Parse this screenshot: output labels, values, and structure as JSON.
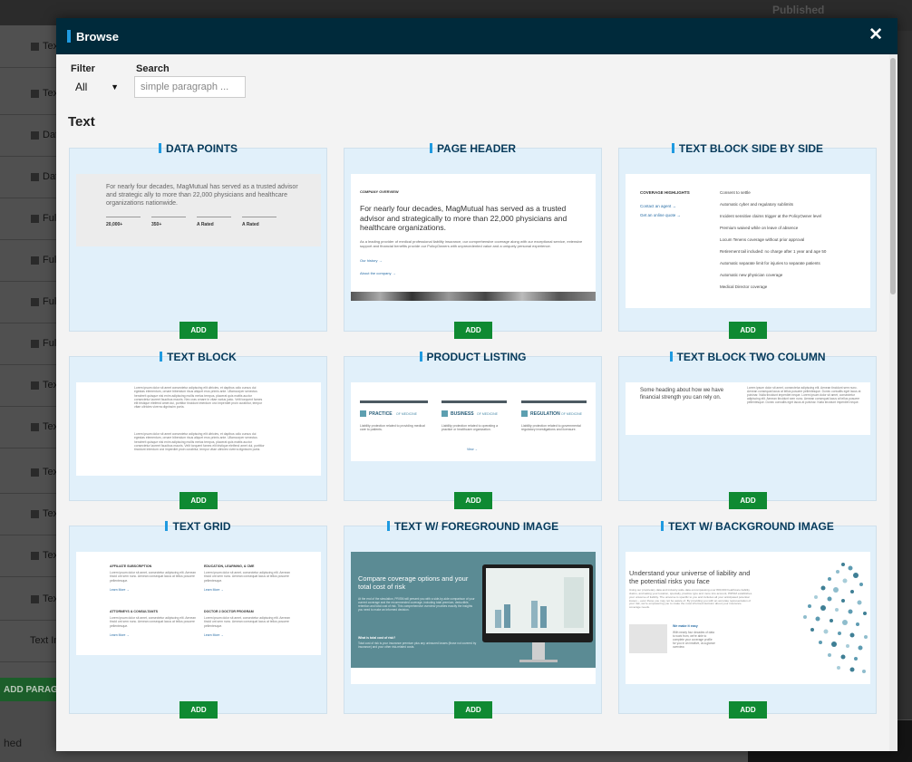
{
  "background": {
    "rows": [
      "Tex",
      "Tex",
      "Dat",
      "Dat",
      "Full",
      "Full",
      "Full",
      "Full",
      "Tex",
      "Tex",
      "Tex",
      "Tex",
      "Tex",
      "Tex",
      "Text Im"
    ],
    "add_paragraph": "ADD PARAGRA",
    "published": "Published",
    "footer_text": "hed"
  },
  "modal": {
    "title": "Browse",
    "close": "✕",
    "filter_label": "Filter",
    "filter_value": "All",
    "search_label": "Search",
    "search_placeholder": "simple paragraph ...",
    "section": "Text",
    "add_label": "ADD"
  },
  "cards": [
    {
      "title": "DATA POINTS",
      "preview": {
        "intro": "For nearly four decades, MagMutual has served as a trusted advisor and strategic ally to more than 22,000 physicians and healthcare organizations nationwide.",
        "stats": [
          "20,000+",
          "350+",
          "A Rated",
          "A Rated"
        ]
      }
    },
    {
      "title": "PAGE HEADER",
      "preview": {
        "eyebrow": "COMPANY OVERVIEW",
        "headline": "For nearly four decades, MagMutual has served as a trusted advisor and strategically to more than 22,000 physicians and healthcare organizations.",
        "body": "As a leading provider of medical professional liability insurance, our comprehensive coverage along with our exceptional service, extensive support and financial benefits provide our PolicyOwners with unprecedented value and a uniquely personal experience.",
        "links": [
          "Our history →",
          "About the company →"
        ]
      }
    },
    {
      "title": "TEXT BLOCK SIDE BY SIDE",
      "preview": {
        "heading": "COVERAGE HIGHLIGHTS",
        "links": [
          "Contact an agent →",
          "Get an online quote →"
        ],
        "items": [
          "Consent to settle",
          "Automatic cyber and regulatory sublimits",
          "Incident sensitive claims trigger at the PolicyOwner level",
          "Premium waived while on leave of absence",
          "Locum Tenens coverage without prior approval",
          "Retirement tail included: no charge after 1 year and age 50",
          "Automatic separate limit for injuries to separate patients",
          "Automatic new physician coverage",
          "Medical Director coverage"
        ]
      }
    },
    {
      "title": "TEXT BLOCK",
      "preview": {
        "body": "Lorem ipsum dolor sit amet consectetur adipiscing elit ultricies, et dapibus odio cursus dui egestas elementum, ornare bibendum risus aliquet eros primis ante. Ullamcorper senectus hendrerit quisque nisi enim adipiscing mollis metus tempus, placerat quis mattis auctor consectetur laoreet faucibus mauris. Nec cras ornare in vitae varius justo. Velit torquent fames elit tristique eleifend amet dui, porttitor tincidunt interdum orci imperdiet proin curabitur, tempor vitae ultricies viverra dignissim porta.",
        "body2": "Lorem ipsum dolor sit amet consectetur adipiscing elit ultricies, et dapibus odio cursus dui egestas elementum, ornare bibendum risus aliquet eros primis ante. Ullamcorper senectus hendrerit quisque nisi enim adipiscing mollis metus tempus, placerat quis mattis auctor consectetur laoreet faucibus mauris. Velit torquent fames elit tristique eleifend amet dui, porttitor tincidunt interdum orci imperdiet proin curabitur, tempor vitae ultricies viverra dignissim porta."
      }
    },
    {
      "title": "PRODUCT LISTING",
      "preview": {
        "items": [
          {
            "name": "PRACTICE",
            "suffix": "OF MEDICINE",
            "desc": "Liability protection related to providing medical care to patients."
          },
          {
            "name": "BUSINESS",
            "suffix": "OF MEDICINE",
            "desc": "Liability protection related to operating a practice or healthcare organization."
          },
          {
            "name": "REGULATION",
            "suffix": "OF MEDICINE",
            "desc": "Liability protection related to governmental regulatory investigations and licensure."
          }
        ],
        "link": "View →"
      }
    },
    {
      "title": "TEXT BLOCK TWO COLUMN",
      "preview": {
        "heading": "Some heading about how we have financial strength you can rely on.",
        "body": "Lorem ipsum dolor sit amet, consectetur adipiscing elit. Aenean tincidunt sem nunc. Aenean consequat lacus at tellus posuere pellentesque. Donec convallis eget lacus at pulvinar. Nulla tincidunt imperdiet neque. Lorem ipsum dolor sit amet, consectetur adipiscing elit. Aenean tincidunt sem nunc. Aenean consequat lacus at tellus posuere pellentesque. Donec convallis eget lacus at pulvinar. Nulla tincidunt imperdiet neque."
      }
    },
    {
      "title": "TEXT GRID",
      "preview": {
        "cells": [
          {
            "heading": "AFFILIATE SUBSCRIPTION",
            "body": "Lorem ipsum dolor sit amet, consectetur adipiscing elit. Aenean tincid unt sem nunc. Aenean consequat lacus at tellus posuere pellentesque.",
            "link": "Learn More →"
          },
          {
            "heading": "EDUCATION, LEARNING, & CME",
            "body": "Lorem ipsum dolor sit amet, consectetur adipiscing elit. Aenean tincid unt sem nunc. Aenean consequat lacus at tellus posuere pellentesque.",
            "link": "Learn More →"
          },
          {
            "heading": "ATTORNEYS & CONSULTANTS",
            "body": "Lorem ipsum dolor sit amet, consectetur adipiscing elit. Aenean tincid unt sem nunc. Aenean consequat lacus at tellus posuere pellentesque.",
            "link": "Learn More →"
          },
          {
            "heading": "DOCTOR 2 DOCTOR PROGRAM",
            "body": "Lorem ipsum dolor sit amet, consectetur adipiscing elit. Aenean tincid unt sem nunc. Aenean consequat lacus at tellus posuere pellentesque.",
            "link": "Learn More →"
          }
        ]
      }
    },
    {
      "title": "TEXT W/ FOREGROUND IMAGE",
      "preview": {
        "headline": "Compare coverage options and your total cost of risk",
        "body": "At the end of the simulation, PRISM will present you with a side-by-side comparison of your current coverage and the recommended coverage, including total premium, deductible, retention and total cost of risk. This comprehensive overview provides exactly the insights you need to make an informed decision.",
        "subhead": "What is total cost of risk?",
        "subbody": "Total cost of risk is your insurance premium plus any uninsured losses (those not covered by insurance) and your other risk-related costs."
      }
    },
    {
      "title": "TEXT W/ BACKGROUND IMAGE",
      "preview": {
        "headline": "Understand your universe of liability and the potential risks you face",
        "body": "Using our proprietary data and industry-wide data encompassing over 800,000 healthcare liability claims, and taking your location, specialty, practice type and more into account, PRISM establishes your universe of liability. The universe is specific to you and includes all your anticipated potential losses – even those you may not be aware of. By providing you with an accurate representation of your risk, we're empowering you to make the most informed decision about your insurance coverage needs.",
        "callout_title": "We make it easy",
        "callout_body": "With nearly four decades of data to work from, we're able to complete your coverage profile for you in an intuitive, at-a-glance overview."
      }
    }
  ]
}
